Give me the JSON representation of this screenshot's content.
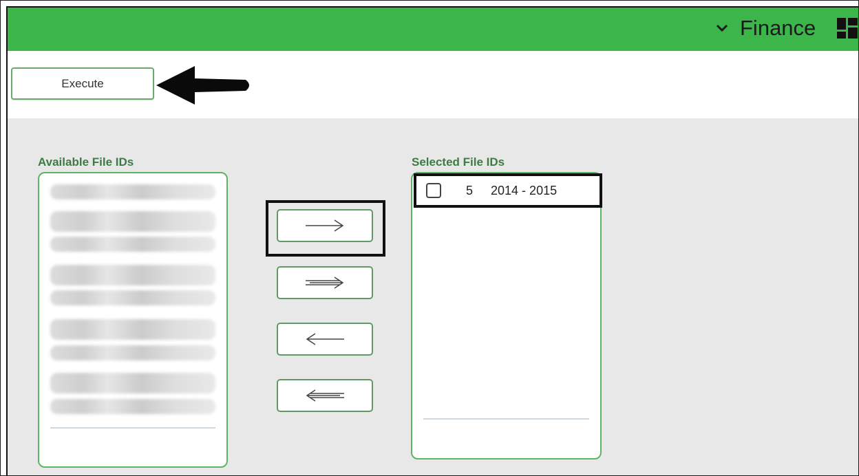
{
  "header": {
    "app_name": "Finance",
    "menu_icon": "chevron-down-icon",
    "grid_icon": "apps-grid-icon",
    "bar_color": "#3cb54a"
  },
  "toolbar": {
    "execute_label": "Execute"
  },
  "available": {
    "title": "Available File IDs",
    "items_obscured": true
  },
  "selected": {
    "title": "Selected File IDs",
    "items": [
      {
        "id": "5",
        "year": "2014 - 2015",
        "checked": false
      }
    ]
  },
  "transfer_buttons": [
    {
      "name": "move-selected-right",
      "icon": "arrow-right-icon"
    },
    {
      "name": "move-all-right",
      "icon": "double-arrow-right-icon"
    },
    {
      "name": "move-selected-left",
      "icon": "arrow-left-icon"
    },
    {
      "name": "move-all-left",
      "icon": "double-arrow-left-icon"
    }
  ],
  "accent_color": "#5cb563"
}
